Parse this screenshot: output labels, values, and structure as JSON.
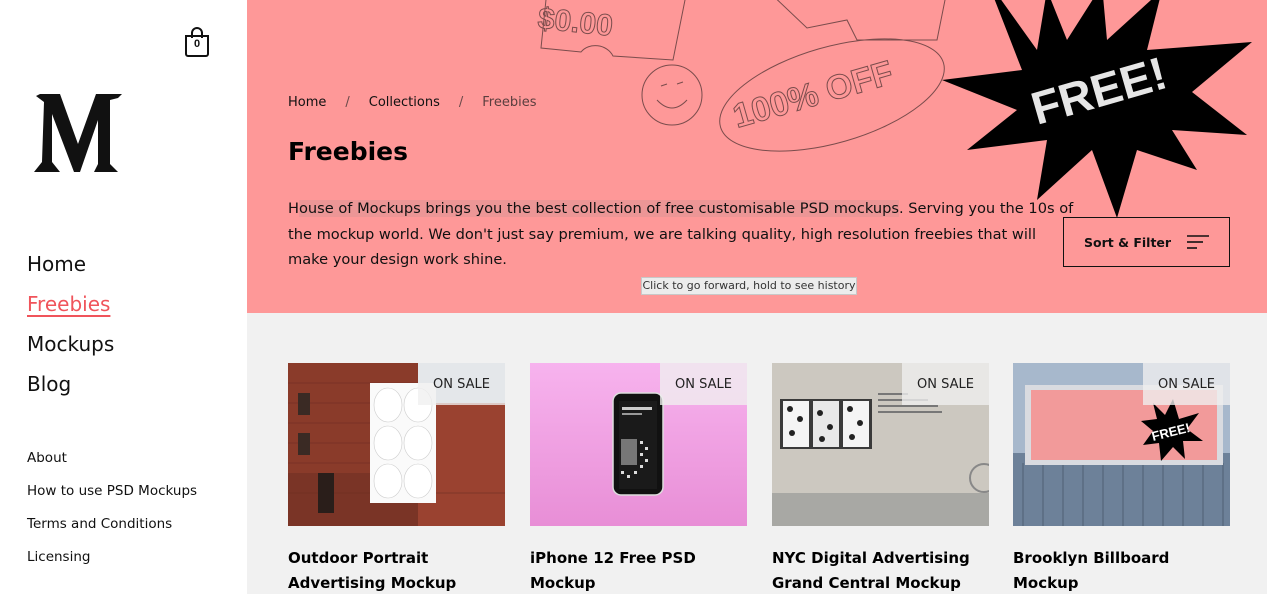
{
  "cart": {
    "count": "0"
  },
  "logo": {
    "alt": "M"
  },
  "nav": {
    "main": [
      {
        "label": "Home",
        "active": false
      },
      {
        "label": "Freebies",
        "active": true
      },
      {
        "label": "Mockups",
        "active": false
      },
      {
        "label": "Blog",
        "active": false
      }
    ],
    "secondary": [
      {
        "label": "About"
      },
      {
        "label": "How to use PSD Mockups"
      },
      {
        "label": "Terms and Conditions"
      },
      {
        "label": "Licensing"
      }
    ]
  },
  "hero": {
    "background": "#fe9898",
    "art_text": {
      "price": "$0.00",
      "discount": "100% OFF",
      "starburst": "FREE!"
    }
  },
  "breadcrumb": [
    {
      "label": "Home"
    },
    {
      "label": "Collections"
    },
    {
      "label": "Freebies"
    }
  ],
  "breadcrumb_separator": "/",
  "page": {
    "title": "Freebies",
    "description_prefix": "H",
    "description_highlight": "ouse of Mockups brings you the best collection of free customisable PSD mockups",
    "description_rest": ". Serving you the 10s of the mockup world. We don't just say premium, we are talking quality, high resolution freebies that will make your design work shine."
  },
  "sort_filter": {
    "label": "Sort & Filter",
    "icon": "filter-lines-icon"
  },
  "tooltip": {
    "text": "Click to go forward, hold to see history"
  },
  "products": [
    {
      "title": "Outdoor Portrait Advertising Mockup",
      "badge": "ON SALE"
    },
    {
      "title": "iPhone 12 Free PSD Mockup",
      "badge": "ON SALE"
    },
    {
      "title": "NYC Digital Advertising Grand Central Mockup",
      "badge": "ON SALE"
    },
    {
      "title": "Brooklyn Billboard Mockup",
      "badge": "ON SALE",
      "image_text": "FREE!"
    }
  ],
  "colors": {
    "accent": "#f0545b",
    "hero": "#fe9898",
    "content_bg": "#f1f1f1"
  }
}
